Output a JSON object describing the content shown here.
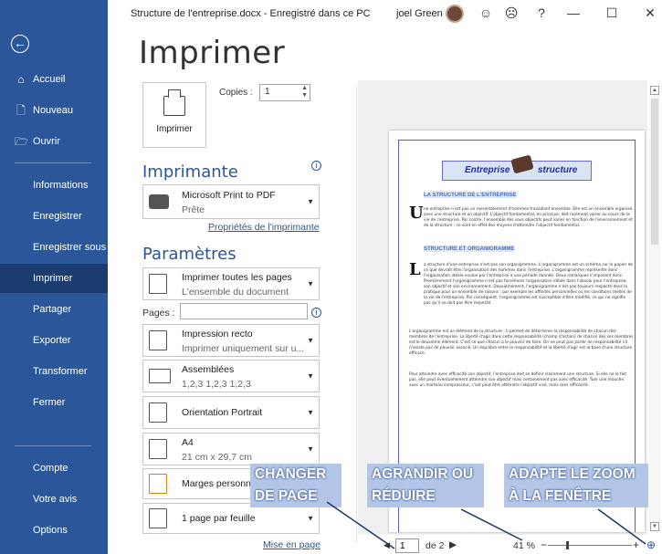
{
  "window": {
    "title": "Structure de l'entreprise.docx  -  Enregistré dans ce PC",
    "user": "joel Green",
    "controls": [
      "☺",
      "☹",
      "?",
      "—",
      "☐",
      "✕"
    ]
  },
  "sidebar": {
    "back_icon": "back-arrow-icon",
    "items": [
      {
        "label": "Accueil",
        "icon": "⌂"
      },
      {
        "label": "Nouveau",
        "icon": "🗋"
      },
      {
        "label": "Ouvrir",
        "icon": "🗁"
      },
      {
        "label": "Informations"
      },
      {
        "label": "Enregistrer"
      },
      {
        "label": "Enregistrer sous"
      },
      {
        "label": "Imprimer"
      },
      {
        "label": "Partager"
      },
      {
        "label": "Exporter"
      },
      {
        "label": "Transformer"
      },
      {
        "label": "Fermer"
      },
      {
        "label": "Compte"
      },
      {
        "label": "Votre avis"
      },
      {
        "label": "Options"
      }
    ]
  },
  "print": {
    "heading": "Imprimer",
    "button_label": "Imprimer",
    "copies_label": "Copies :",
    "copies_value": "1"
  },
  "printer": {
    "section": "Imprimante",
    "name": "Microsoft Print to PDF",
    "status": "Prête",
    "properties_link": "Propriétés de l'imprimante"
  },
  "settings": {
    "section": "Paramètres",
    "pages_label": "Pages :",
    "pages_value": "",
    "options": [
      {
        "t1": "Imprimer toutes les pages",
        "t2": "L'ensemble du document"
      },
      {
        "t1": "Impression recto",
        "t2": "Imprimer uniquement sur u..."
      },
      {
        "t1": "Assemblées",
        "t2": "1,2,3    1,2,3    1,2,3"
      },
      {
        "t1": "Orientation Portrait",
        "t2": ""
      },
      {
        "t1": "A4",
        "t2": "21 cm x 29,7 cm"
      },
      {
        "t1": "Marges personna",
        "t2": ""
      },
      {
        "t1": "1 page par feuille",
        "t2": ""
      }
    ],
    "page_setup_link": "Mise en page"
  },
  "preview_doc": {
    "header_left": "Entreprise",
    "header_right": "structure",
    "h1": "LA STRUCTURE DE L'ENTREPRISE",
    "p1": "ne entreprise n'est pas un rassemblement d'hommes travaillant ensemble. Elle est un ensemble organisé, avec une structure et un objectif. L'objectif fondamental, en principe, doit rarement varier au cours de la vie de l'entreprise. Par contre, l'ensemble des sous objectifs peut varier en fonction de l'environnement et de la structure : ce sont en effet des moyens d'atteindre l'objectif fondamental.",
    "h2": "STRUCTURE ET ORGANIGRAMME",
    "p2": "a structure d'une entreprise n'est pas son organigramme. L'organigramme est un schéma sur le papier de ce que devrait être l'organisation des hommes dans l'entreprise. L'organigramme représente donc l'organisation idéale voulue par l'entreprise à une période donnée. Deux remarques s'imposent donc. Premièrement l'organigramme n'est pas forcément l'organisation idéale dans l'absolu pour l'entreprise, son objectif et son environnement. Deuxièmement, l'organigramme n'est pas toujours respecté dans la pratique pour un ensemble de raisons : par exemple les affinités personnelles ou les conditions réelles de la vie de l'entreprise. Par conséquent, l'organigramme est susceptible d'être modifié, ce qui ne signifie pas qu'il ne doit pas être respecté.",
    "p3": "L'organigramme est un élément de la structure : il permet de déterminer la responsabilité de chacun des membres de l'entreprise. La liberté d'agir dans cette responsabilité (champ d'action) de chacun des ses membres est le deuxième élément. C'est ce que chacun a le pouvoir de faire. On ne peut pas parler de responsabilité s'il n'existe pas de pouvoir associé. Un équilibre entre la responsabilité et la liberté d'agir est la base d'une structure efficace.",
    "p4": "Pour atteindre avec efficacité son objectif, l'entreprise doit se définir clairement une structure. Si elle ne le fait pas, elle peut éventuellement atteindre son objectif mais certainement pas avec efficacité. Tuer une mouche avec un marteau compresseur, c'est peut être atteindre l'objectif visé, mais sans efficacité."
  },
  "callouts": {
    "change_page": "CHANGER DE PAGE",
    "zoom": "AGRANDIR OU RÉDUIRE",
    "fit": "ADAPTE LE ZOOM À LA FENÊTRE"
  },
  "navigation": {
    "prev": "◀",
    "page_value": "1",
    "of_pages": "de 2",
    "next": "▶",
    "zoom_level": "41 %",
    "zoom_out": "−",
    "zoom_in": "+",
    "fit_icon": "fit-to-window-icon"
  },
  "colors": {
    "sidebar": "#2b579a",
    "sidebar_selected": "#1a3c6e",
    "accent": "#2b579a",
    "callout": "#b4c6e7"
  }
}
